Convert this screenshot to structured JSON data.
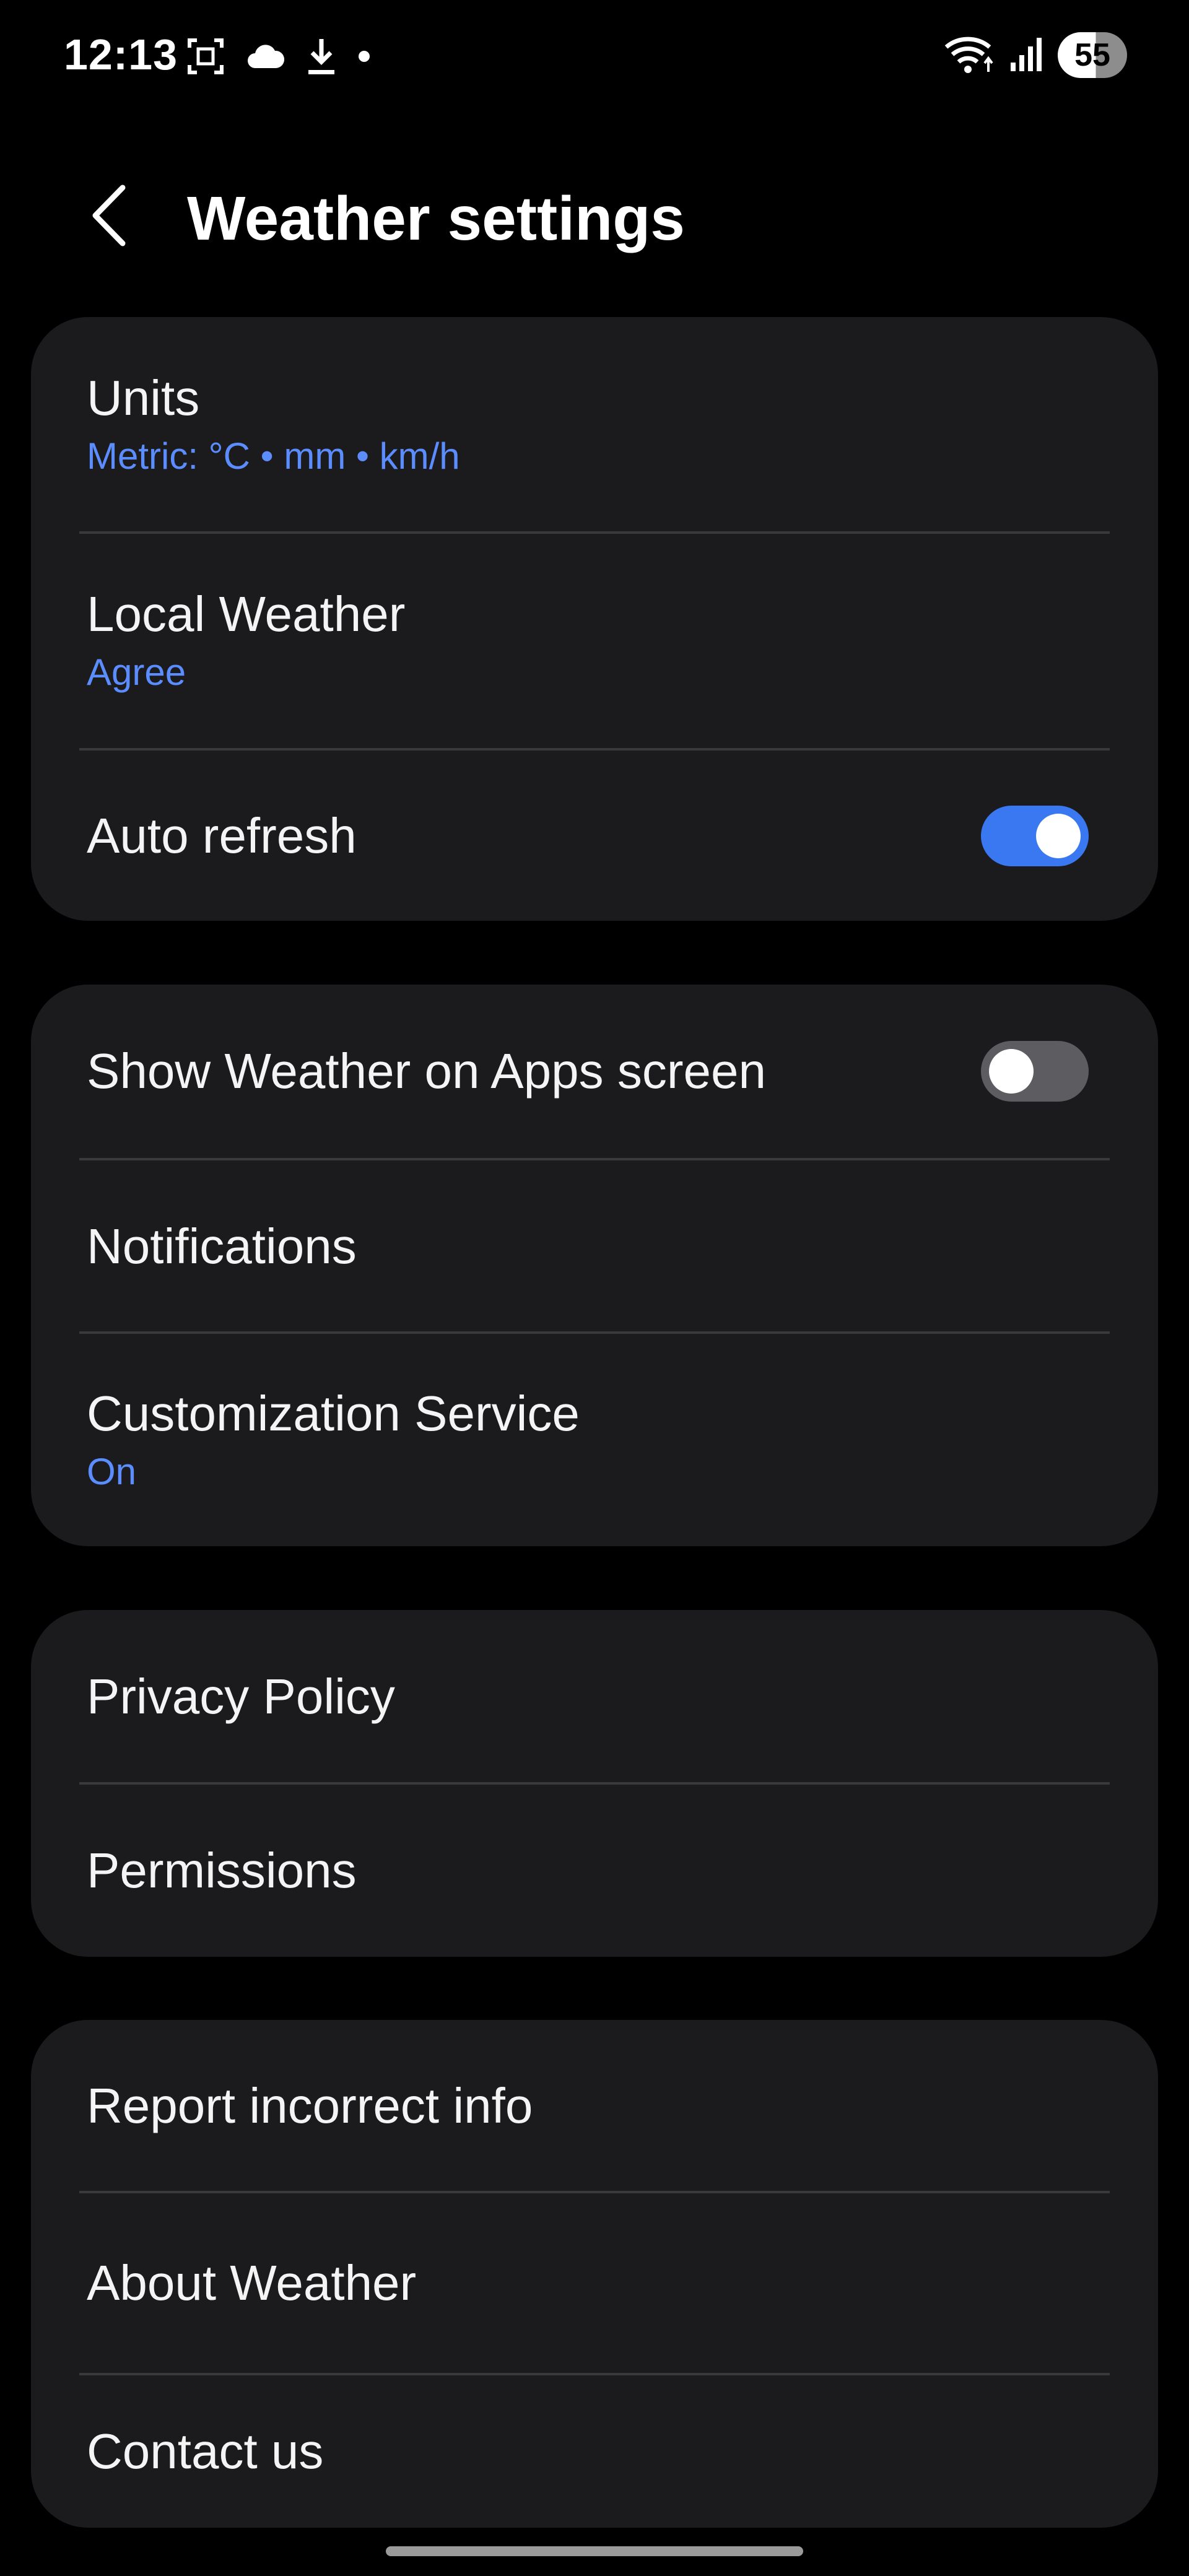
{
  "status_bar": {
    "time": "12:13",
    "left_icons": [
      "screenshot-icon",
      "cloud-icon",
      "download-icon",
      "dot-icon"
    ],
    "right_icons": [
      "wifi-icon",
      "signal-icon"
    ],
    "battery": "55"
  },
  "header": {
    "back_icon": "chevron-left-icon",
    "title": "Weather settings"
  },
  "card1": {
    "units": {
      "title": "Units",
      "value": "Metric: °C • mm • km/h"
    },
    "local_weather": {
      "title": "Local Weather",
      "value": "Agree"
    },
    "auto_refresh": {
      "title": "Auto refresh",
      "enabled": true
    }
  },
  "card2": {
    "show_weather_apps": {
      "title": "Show Weather on Apps screen",
      "enabled": false
    },
    "notifications": {
      "title": "Notifications"
    },
    "customization": {
      "title": "Customization Service",
      "value": "On"
    }
  },
  "card3": {
    "privacy": {
      "title": "Privacy Policy"
    },
    "permissions": {
      "title": "Permissions"
    }
  },
  "card4": {
    "report": {
      "title": "Report incorrect info"
    },
    "about": {
      "title": "About Weather"
    },
    "contact": {
      "title": "Contact us"
    }
  },
  "colors": {
    "background": "#000000",
    "card": "#1b1b1d",
    "accent": "#3a78f2",
    "subtitle": "#5c8dff"
  }
}
